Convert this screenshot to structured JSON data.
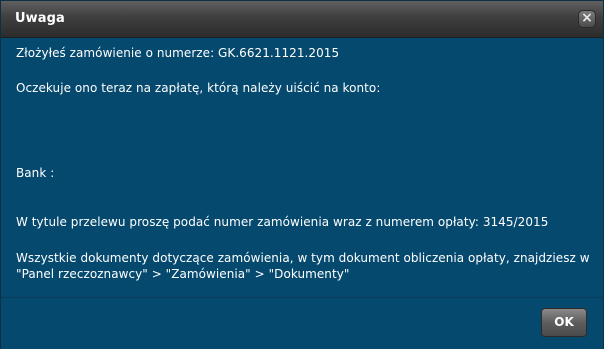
{
  "dialog": {
    "title": "Uwaga",
    "close_icon": "close-icon",
    "lines": [
      "Złożyłeś zamówienie o numerze: GK.6621.1121.2015",
      "Oczekuje ono teraz na zapłatę, którą należy uiścić na konto:",
      "Bank :",
      "W tytule przelewu proszę podać numer zamówienia wraz z numerem opłaty: 3145/2015",
      "Wszystkie dokumenty dotyczące zamówienia, w tym dokument obliczenia opłaty, znajdziesz w",
      "\"Panel rzeczoznawcy\" > \"Zamówienia\" > \"Dokumenty\""
    ],
    "ok_label": "OK"
  },
  "colors": {
    "body_background": "#05496f",
    "titlebar_background": "#3f3f3f",
    "text": "#ffffff"
  }
}
